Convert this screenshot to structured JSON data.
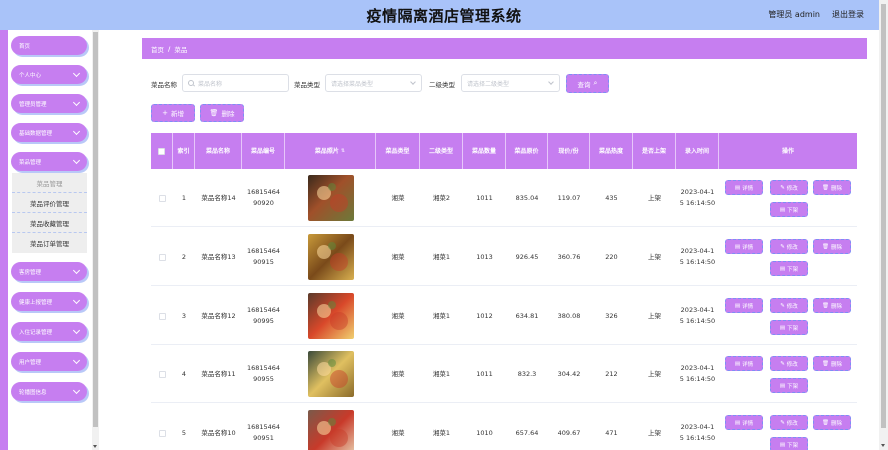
{
  "header": {
    "title": "疫情隔离酒店管理系统",
    "user_label": "管理员 admin",
    "logout_label": "退出登录"
  },
  "sidebar": {
    "items": [
      {
        "label": "首页",
        "has_chevron": false
      },
      {
        "label": "个人中心",
        "has_chevron": true
      },
      {
        "label": "管理员管理",
        "has_chevron": true
      },
      {
        "label": "基础数据管理",
        "has_chevron": true
      },
      {
        "label": "菜品管理",
        "has_chevron": true
      },
      {
        "label": "客房管理",
        "has_chevron": true
      },
      {
        "label": "健康上报管理",
        "has_chevron": true
      },
      {
        "label": "入住记录管理",
        "has_chevron": true
      },
      {
        "label": "用户管理",
        "has_chevron": true
      },
      {
        "label": "轮播图信息",
        "has_chevron": true
      }
    ],
    "submenu": [
      "菜品管理",
      "菜品评价管理",
      "菜品收藏管理",
      "菜品订单管理"
    ]
  },
  "breadcrumb": {
    "home": "首页",
    "sep": "/",
    "current": "菜品"
  },
  "search": {
    "name_label": "菜品名称",
    "name_placeholder": "菜品名称",
    "type_label": "菜品类型",
    "type_placeholder": "请选择菜品类型",
    "subtype_label": "二级类型",
    "subtype_placeholder": "请选择二级类型",
    "query_label": "查询"
  },
  "actions": {
    "add_label": "新增",
    "delete_label": "删除"
  },
  "table": {
    "headers": [
      "索引",
      "菜品名称",
      "菜品编号",
      "菜品照片",
      "菜品类型",
      "二级类型",
      "菜品数量",
      "菜品原价",
      "现价/份",
      "菜品热度",
      "是否上架",
      "录入时间",
      "操作"
    ],
    "row_buttons": {
      "detail": "详情",
      "edit": "修改",
      "delete": "删除",
      "offline": "下架"
    },
    "rows": [
      {
        "index": "1",
        "name": "菜品名称14",
        "code": "16815464\n90920",
        "type": "湘菜",
        "subtype": "湘菜2",
        "qty": "1011",
        "orig": "835.04",
        "price": "119.07",
        "heat": "435",
        "status": "上架",
        "time": "2023-04-1\n5 16:14:50"
      },
      {
        "index": "2",
        "name": "菜品名称13",
        "code": "16815464\n90915",
        "type": "湘菜",
        "subtype": "湘菜1",
        "qty": "1013",
        "orig": "926.45",
        "price": "360.76",
        "heat": "220",
        "status": "上架",
        "time": "2023-04-1\n5 16:14:50"
      },
      {
        "index": "3",
        "name": "菜品名称12",
        "code": "16815464\n90995",
        "type": "湘菜",
        "subtype": "湘菜1",
        "qty": "1012",
        "orig": "634.81",
        "price": "380.08",
        "heat": "326",
        "status": "上架",
        "time": "2023-04-1\n5 16:14:50"
      },
      {
        "index": "4",
        "name": "菜品名称11",
        "code": "16815464\n90955",
        "type": "湘菜",
        "subtype": "湘菜1",
        "qty": "1011",
        "orig": "832.3",
        "price": "304.42",
        "heat": "212",
        "status": "上架",
        "time": "2023-04-1\n5 16:14:50"
      },
      {
        "index": "5",
        "name": "菜品名称10",
        "code": "16815464\n90951",
        "type": "湘菜",
        "subtype": "湘菜1",
        "qty": "1010",
        "orig": "657.64",
        "price": "409.67",
        "heat": "471",
        "status": "上架",
        "time": "2023-04-1\n5 16:14:50"
      }
    ]
  },
  "colors": {
    "accent": "#c67ef0",
    "header_bg": "#a9c3f9",
    "dashed_border": "#7d8ff5"
  }
}
